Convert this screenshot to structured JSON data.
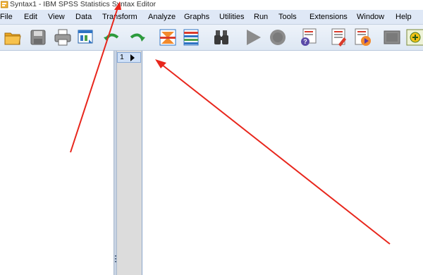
{
  "window": {
    "title": "Syntax1 - IBM SPSS Statistics Syntax Editor"
  },
  "menu": [
    {
      "label": "File"
    },
    {
      "label": "Edit"
    },
    {
      "label": "View"
    },
    {
      "label": "Data"
    },
    {
      "label": "Transform"
    },
    {
      "label": "Analyze"
    },
    {
      "label": "Graphs"
    },
    {
      "label": "Utilities"
    },
    {
      "label": "Run"
    },
    {
      "label": "Tools"
    },
    {
      "label": "Extensions"
    },
    {
      "label": "Window"
    },
    {
      "label": "Help"
    }
  ],
  "toolbar": {
    "icons": [
      "open-folder-icon",
      "save-icon",
      "print-icon",
      "recall-dialog-icon",
      "undo-icon",
      "redo-icon",
      "go-to-case-icon",
      "variables-icon",
      "find-icon",
      "run-icon",
      "stop-icon",
      "syntax-help-icon",
      "comment-icon",
      "run-to-end-icon",
      "validate-icon",
      "add-breakpoint-icon"
    ]
  },
  "editor": {
    "lines": [
      {
        "number": "1"
      }
    ]
  },
  "colors": {
    "menubar": "#dfe8f6",
    "gutter": "#dcdcdc",
    "current_line": "#cfe0f7",
    "annotation_arrow": "#e8261c"
  }
}
